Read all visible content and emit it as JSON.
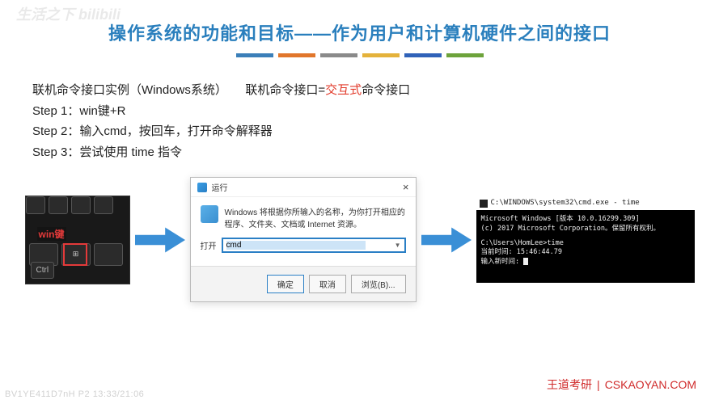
{
  "watermark_tl": "生活之下 bilibili",
  "title": "操作系统的功能和目标——作为用户和计算机硬件之间的接口",
  "content": {
    "line1_prefix": "联机命令接口实例（Windows系统）　　联机命令接口=",
    "line1_highlight": "交互式",
    "line1_suffix": "命令接口",
    "step1": "Step 1：win键+R",
    "step2": "Step 2：输入cmd，按回车，打开命令解释器",
    "step3": "Step 3：尝试使用 time 指令"
  },
  "keyboard": {
    "label": "win键",
    "ctrl": "Ctrl"
  },
  "rundlg": {
    "title": "运行",
    "close": "×",
    "message": "Windows 将根据你所输入的名称，为你打开相应的程序、文件夹、文档或 Internet 资源。",
    "open_label": "打开",
    "input_value": "cmd",
    "btn_ok": "确定",
    "btn_cancel": "取消",
    "btn_browse": "浏览(B)..."
  },
  "cmd": {
    "title": "C:\\WINDOWS\\system32\\cmd.exe - time",
    "line1": "Microsoft Windows [版本 10.0.16299.309]",
    "line2": "(c) 2017 Microsoft Corporation。保留所有权利。",
    "line3": "C:\\Users\\HomLee>time",
    "line4": "当前时间: 15:46:44.79",
    "line5": "输入新时间: "
  },
  "footer": {
    "brand": "王道考研",
    "url": "CSKAOYAN.COM"
  },
  "videometa": "BV1YE411D7nH P2 13:33/21:06"
}
